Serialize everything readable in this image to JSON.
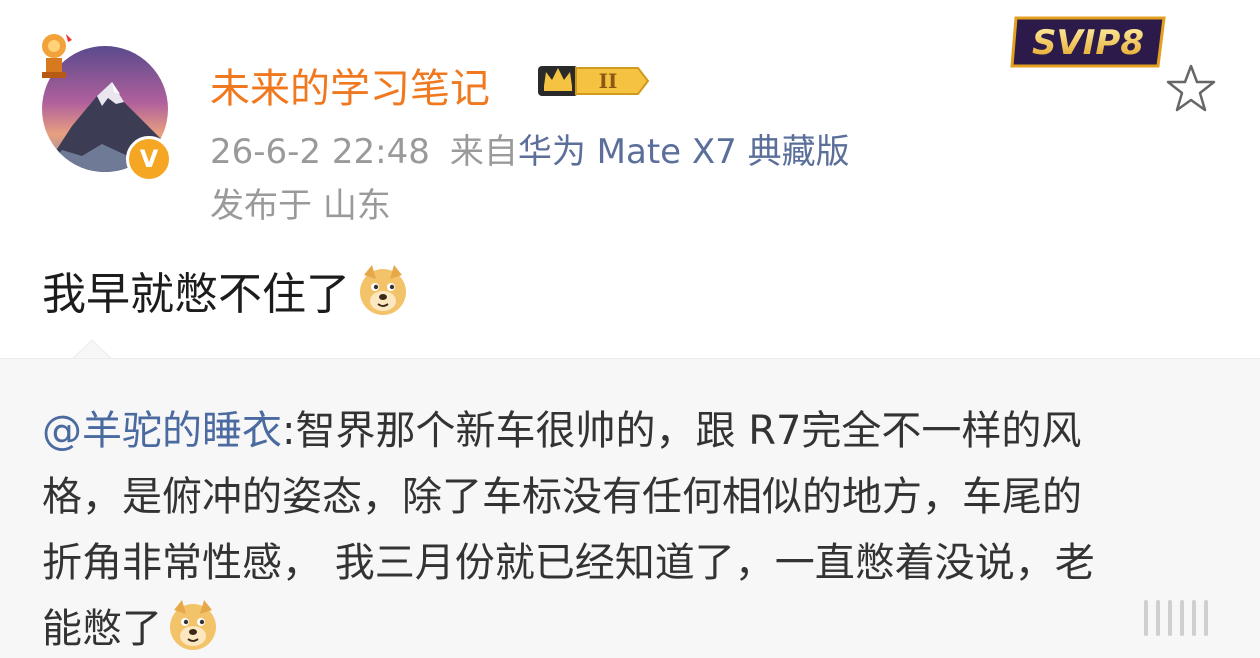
{
  "post": {
    "username": "未来的学习笔记",
    "member_level": "II",
    "svip_label": "SVIP8",
    "verified_mark": "V",
    "timestamp": "26-6-2 22:48",
    "from_label": "来自",
    "device": "华为 Mate X7 典藏版",
    "location_label": "发布于",
    "location": "山东",
    "text": "我早就憋不住了",
    "icons": {
      "favorite": "star-outline-icon",
      "emoji": "doge-emoji-icon",
      "more": "more-icon"
    }
  },
  "quote": {
    "mention": "@羊驼的睡衣",
    "lines": [
      ":智界那个新车很帅的，跟 R7完全不一样的风",
      "格，是俯冲的姿态，除了车标没有任何相似的地方，车尾的",
      "折角非常性感， 我三月份就已经知道了，一直憋着没说，老",
      "能憋了"
    ]
  },
  "colors": {
    "username": "#f0781e",
    "mention": "#4a6aa0",
    "device": "#5b6f9a",
    "meta": "#9a9a9a",
    "quote_bg": "#f7f7f7"
  }
}
